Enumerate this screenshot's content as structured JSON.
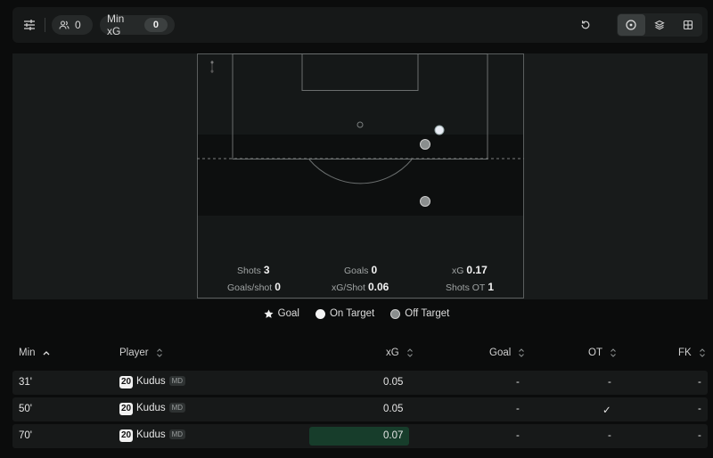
{
  "toolbar": {
    "players_count": "0",
    "min_xg_label": "Min xG",
    "min_xg_value": "0"
  },
  "stats": {
    "shots_label": "Shots",
    "shots_value": "3",
    "goals_label": "Goals",
    "goals_value": "0",
    "xg_label": "xG",
    "xg_value": "0.17",
    "goals_per_shot_label": "Goals/shot",
    "goals_per_shot_value": "0",
    "xg_per_shot_label": "xG/Shot",
    "xg_per_shot_value": "0.06",
    "shots_ot_label": "Shots OT",
    "shots_ot_value": "1"
  },
  "legend": {
    "goal": "Goal",
    "on_target": "On Target",
    "off_target": "Off Target"
  },
  "table": {
    "headers": {
      "min": "Min",
      "player": "Player",
      "xg": "xG",
      "goal": "Goal",
      "ot": "OT",
      "fk": "FK"
    },
    "rows": [
      {
        "min": "31'",
        "number": "20",
        "player": "Kudus",
        "pos": "MD",
        "xg": "0.05",
        "goal": "-",
        "ot": "-",
        "fk": "-"
      },
      {
        "min": "50'",
        "number": "20",
        "player": "Kudus",
        "pos": "MD",
        "xg": "0.05",
        "goal": "-",
        "ot": "✓",
        "fk": "-"
      },
      {
        "min": "70'",
        "number": "20",
        "player": "Kudus",
        "pos": "MD",
        "xg": "0.07",
        "goal": "-",
        "ot": "-",
        "fk": "-"
      }
    ]
  },
  "colors": {
    "on_target": "#e8ecf4",
    "off_target": "#8a8e8e",
    "highlight": "#173d2b"
  },
  "icons": {
    "filter": "sliders-icon",
    "players": "users-icon",
    "reset": "refresh-icon",
    "view_shots": "target-icon",
    "view_layers": "layers-icon",
    "view_grid": "grid-icon"
  }
}
